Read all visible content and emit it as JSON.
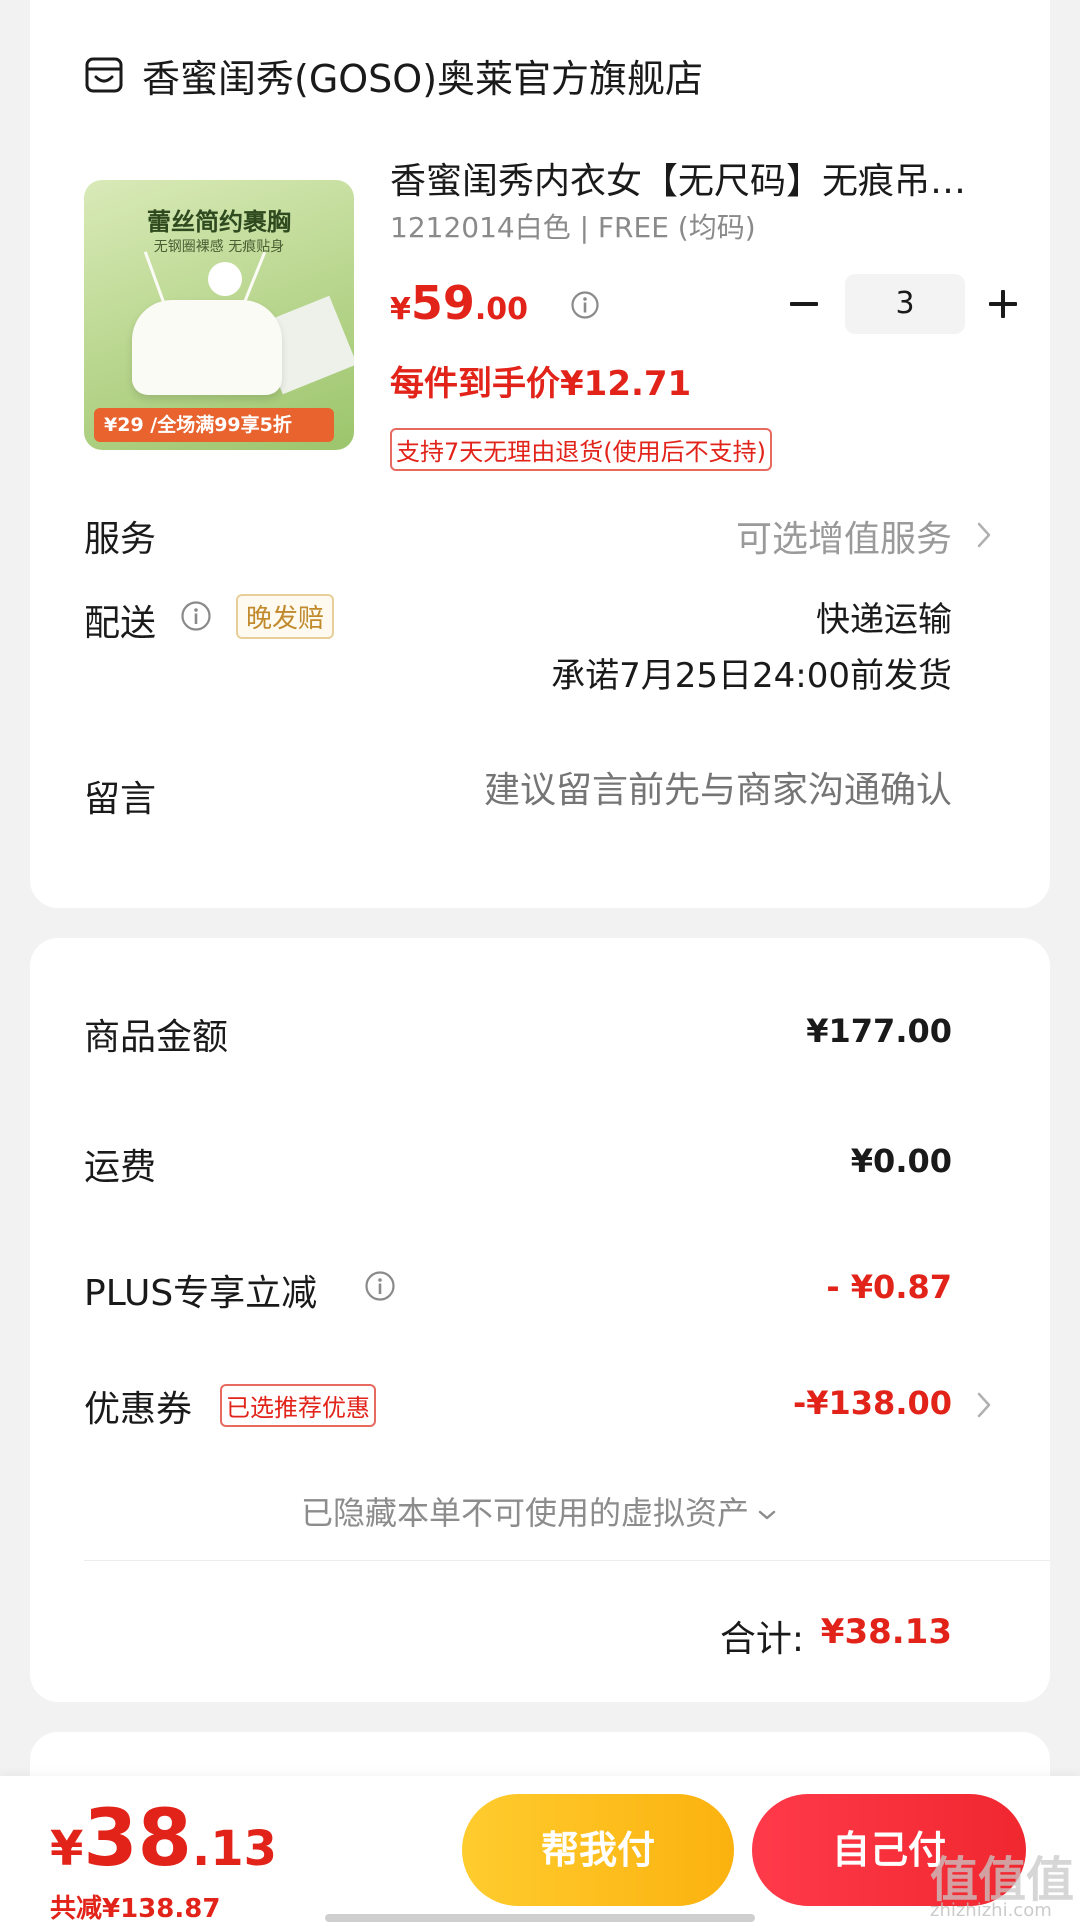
{
  "store": {
    "name": "香蜜闺秀(GOSO)奥莱官方旗舰店",
    "icon": "store-icon"
  },
  "product": {
    "image_headline": "蕾丝简约裹胸",
    "image_subline": "无钢圈裸感 无痕贴身",
    "image_banner": "¥29 /全场满99享5折",
    "title": "香蜜闺秀内衣女【无尺码】无痕吊带裹胸",
    "spec": "1212014白色 | FREE (均码)",
    "price_symbol": "¥",
    "price_int": "59",
    "price_dec": ".00",
    "quantity": "3",
    "per_item_price": "每件到手价¥12.71",
    "return_policy": "支持7天无理由退货(使用后不支持)"
  },
  "service": {
    "label": "服务",
    "value": "可选增值服务"
  },
  "delivery": {
    "label": "配送",
    "tag": "晚发赔",
    "method": "快递运输",
    "promise": "承诺7月25日24:00前发货"
  },
  "message": {
    "label": "留言",
    "placeholder": "建议留言前先与商家沟通确认"
  },
  "summary": {
    "goods_label": "商品金额",
    "goods_value": "¥177.00",
    "shipping_label": "运费",
    "shipping_value": "¥0.00",
    "plus_label": "PLUS专享立减",
    "plus_value": "- ¥0.87",
    "coupon_label": "优惠券",
    "coupon_tag": "已选推荐优惠",
    "coupon_value": "-¥138.00",
    "hidden_assets": "已隐藏本单不可使用的虚拟资产",
    "total_label": "合计:",
    "total_value": "¥38.13"
  },
  "bottom": {
    "price_symbol": "¥",
    "price_int": "38",
    "price_dec": ".13",
    "saved": "共减¥138.87",
    "help_pay": "帮我付",
    "self_pay": "自己付"
  },
  "watermark": {
    "text": "值值值",
    "sub": "zhizhizhi.com"
  },
  "colors": {
    "accent_red": "#e2231a",
    "help_yellow": "#fbb20f",
    "pay_red": "#f0272f"
  }
}
